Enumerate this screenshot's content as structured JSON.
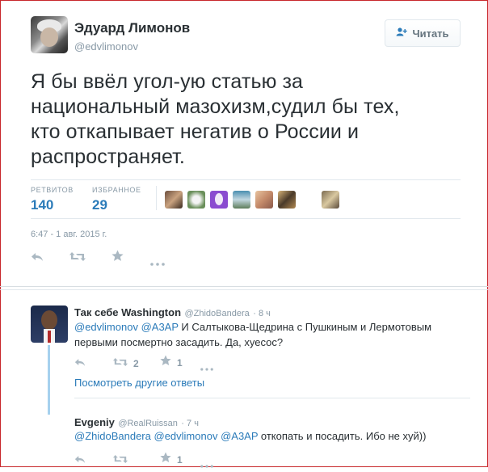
{
  "tweet": {
    "author_name": "Эдуард Лимонов",
    "author_handle": "@edvlimonov",
    "follow_label": "Читать",
    "text_lines": [
      "Я бы ввёл угол-ую статью за",
      "национальный мазохизм,судил бы тех,",
      "кто откапывает негатив о России и",
      "распространяет."
    ],
    "retweets_label": "РЕТВИТОВ",
    "retweets_count": "140",
    "favorites_label": "ИЗБРАННОЕ",
    "favorites_count": "29",
    "timestamp": "6:47 - 1 авг. 2015 г."
  },
  "replies": [
    {
      "name": "Так себе Washington",
      "handle": "@ZhidoBandera",
      "time": "· 8 ч",
      "mentions": [
        "@edvlimonov",
        "@A3AP"
      ],
      "text_rest": " И Салтыкова-Щедрина с Пушкиным и Лермотовым",
      "text_line2": "первыми посмертно засадить. Да, хуесос?",
      "retweets": "2",
      "favorites": "1",
      "more_replies_link": "Посмотреть другие ответы"
    },
    {
      "name": "Evgeniy",
      "handle": "@RealRuissan",
      "time": "· 7 ч",
      "mentions": [
        "@ZhidoBandera",
        "@edvlimonov",
        "@A3AP"
      ],
      "text_rest": " откопать и посадить. Ибо не хуй))",
      "favorites": "1"
    }
  ],
  "icons": {
    "reply": "reply-icon",
    "retweet": "retweet-icon",
    "favorite": "star-icon",
    "more": "more-icon",
    "follow": "add-user-icon"
  },
  "colors": {
    "link": "#2b7bb9",
    "muted": "#8899a6",
    "frame": "#c8272b"
  }
}
